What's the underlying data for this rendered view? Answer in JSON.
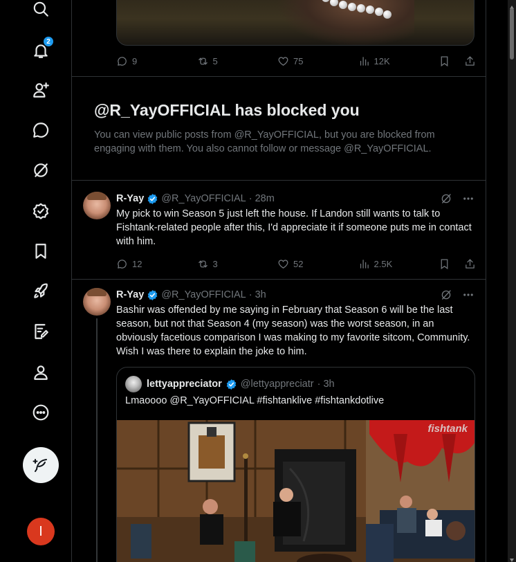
{
  "sidebar": {
    "notifications_badge": "2",
    "profile_initial": "I"
  },
  "top_post": {
    "replies": "9",
    "reposts": "5",
    "likes": "75",
    "views": "12K"
  },
  "blocked_notice": {
    "title": "@R_YayOFFICIAL has blocked you",
    "description": "You can view public posts from @R_YayOFFICIAL, but you are blocked from engaging with them. You also cannot follow or message @R_YayOFFICIAL."
  },
  "tweets": [
    {
      "name": "R-Yay",
      "handle": "@R_YayOFFICIAL",
      "time": "· 28m",
      "text": "My pick to win Season 5 just left the house. If Landon still wants to talk to Fishtank-related people after this, I'd appreciate it if someone puts me in contact with him.",
      "replies": "12",
      "reposts": "3",
      "likes": "52",
      "views": "2.5K"
    },
    {
      "name": "R-Yay",
      "handle": "@R_YayOFFICIAL",
      "time": "· 3h",
      "text": "Bashir was offended by me saying in February that Season 6 will be the last season, but not that Season 4 (my season) was the worst season, in an obviously facetious comparison I was making to my favorite sitcom, Community. Wish I was there to explain the joke to him."
    }
  ],
  "quote": {
    "name": "lettyappreciator",
    "handle": "@lettyappreciatr",
    "time": "· 3h",
    "text": "Lmaoooo @R_YayOFFICIAL #fishtanklive #fishtankdotlive",
    "watermark": "fishtank"
  },
  "colors": {
    "accent": "#1d9bf0",
    "text": "#e7e9ea",
    "muted": "#71767b",
    "border": "#2f3336",
    "avatar_me": "#d9381e"
  }
}
